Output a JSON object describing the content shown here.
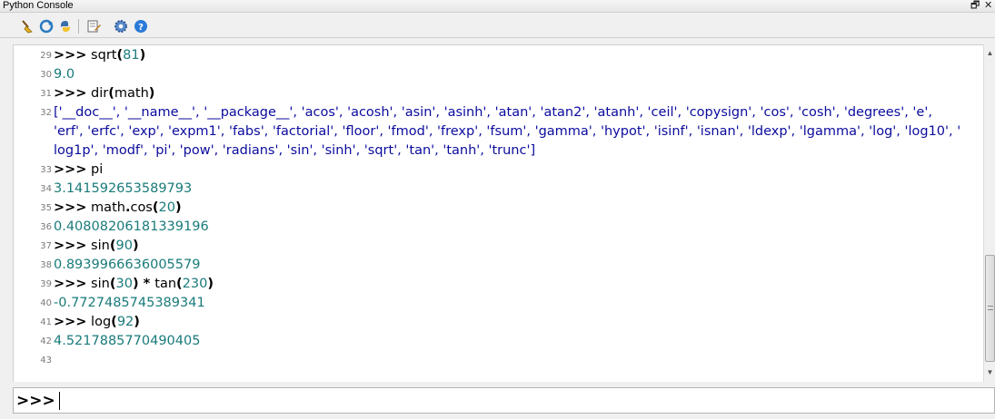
{
  "window": {
    "title": "Python Console",
    "restore_symbol": "🗗",
    "close_symbol": "✕"
  },
  "toolbar": {
    "icons": [
      "clear-console-icon",
      "run-script-icon",
      "python-icon",
      "editor-icon",
      "settings-icon",
      "help-icon"
    ]
  },
  "lines": [
    {
      "n": "29",
      "kind": "cmd",
      "prompt": ">>>",
      "parts": [
        {
          "t": " sqrt",
          "c": "kw"
        },
        {
          "t": "(",
          "c": "paren"
        },
        {
          "t": "81",
          "c": "num"
        },
        {
          "t": ")",
          "c": "paren"
        }
      ]
    },
    {
      "n": "30",
      "kind": "out",
      "text": "9.0"
    },
    {
      "n": "31",
      "kind": "cmd",
      "prompt": ">>>",
      "parts": [
        {
          "t": " dir",
          "c": "kw"
        },
        {
          "t": "(",
          "c": "paren"
        },
        {
          "t": "math",
          "c": "kw"
        },
        {
          "t": ")",
          "c": "paren"
        }
      ]
    },
    {
      "n": "32",
      "kind": "list",
      "rows": [
        "['__doc__', '__name__', '__package__', 'acos', 'acosh', 'asin', 'asinh', 'atan', 'atan2', 'atanh', 'ceil', 'copysign', 'cos', 'cosh', 'degrees', 'e',",
        "'erf', 'erfc', 'exp', 'expm1', 'fabs', 'factorial', 'floor', 'fmod', 'frexp', 'fsum', 'gamma', 'hypot', 'isinf', 'isnan', 'ldexp', 'lgamma', 'log', 'log10', '",
        "log1p', 'modf', 'pi', 'pow', 'radians', 'sin', 'sinh', 'sqrt', 'tan', 'tanh', 'trunc']"
      ]
    },
    {
      "n": "33",
      "kind": "cmd",
      "prompt": ">>>",
      "parts": [
        {
          "t": " pi",
          "c": "kw"
        }
      ]
    },
    {
      "n": "34",
      "kind": "out",
      "text": "3.141592653589793"
    },
    {
      "n": "35",
      "kind": "cmd",
      "prompt": ">>>",
      "parts": [
        {
          "t": " math",
          "c": "kw"
        },
        {
          "t": ".",
          "c": "paren"
        },
        {
          "t": "cos",
          "c": "kw"
        },
        {
          "t": "(",
          "c": "paren"
        },
        {
          "t": "20",
          "c": "num"
        },
        {
          "t": ")",
          "c": "paren"
        }
      ]
    },
    {
      "n": "36",
      "kind": "out",
      "text": "0.40808206181339196"
    },
    {
      "n": "37",
      "kind": "cmd",
      "prompt": ">>>",
      "parts": [
        {
          "t": " sin",
          "c": "kw"
        },
        {
          "t": "(",
          "c": "paren"
        },
        {
          "t": "90",
          "c": "num"
        },
        {
          "t": ")",
          "c": "paren"
        }
      ]
    },
    {
      "n": "38",
      "kind": "out",
      "text": "0.8939966636005579"
    },
    {
      "n": "39",
      "kind": "cmd",
      "prompt": ">>>",
      "parts": [
        {
          "t": " sin",
          "c": "kw"
        },
        {
          "t": "(",
          "c": "paren"
        },
        {
          "t": "30",
          "c": "num"
        },
        {
          "t": ")",
          "c": "paren"
        },
        {
          "t": " * ",
          "c": "paren"
        },
        {
          "t": "tan",
          "c": "kw"
        },
        {
          "t": "(",
          "c": "paren"
        },
        {
          "t": "230",
          "c": "num"
        },
        {
          "t": ")",
          "c": "paren"
        }
      ]
    },
    {
      "n": "40",
      "kind": "out",
      "text": "-0.7727485745389341"
    },
    {
      "n": "41",
      "kind": "cmd",
      "prompt": ">>>",
      "parts": [
        {
          "t": " log",
          "c": "kw"
        },
        {
          "t": "(",
          "c": "paren"
        },
        {
          "t": "92",
          "c": "num"
        },
        {
          "t": ")",
          "c": "paren"
        }
      ]
    },
    {
      "n": "42",
      "kind": "out",
      "text": "4.5217885770490405"
    },
    {
      "n": "43",
      "kind": "empty"
    }
  ],
  "input": {
    "prompt": ">>>",
    "value": ""
  },
  "colors": {
    "number": "#1a7a7a",
    "output": "#1a7a7a",
    "list_output": "#0b0b9e",
    "line_number": "#7a7a7a"
  }
}
